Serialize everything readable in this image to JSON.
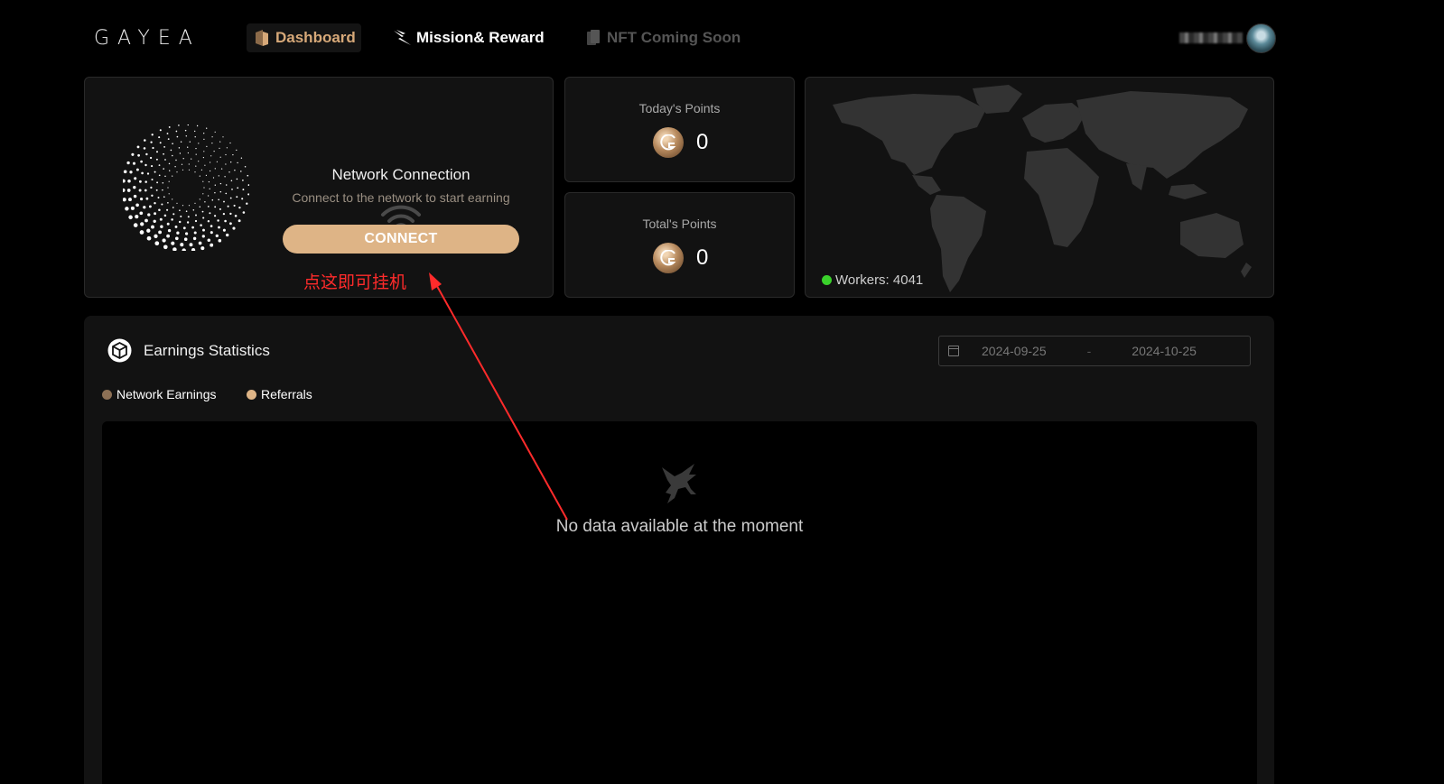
{
  "header": {
    "logo": "GAYEA",
    "nav": [
      {
        "label": "Dashboard",
        "icon": "dashboard-icon",
        "active": true
      },
      {
        "label": "Mission& Reward",
        "icon": "mission-icon",
        "active": false
      },
      {
        "label": "NFT Coming Soon",
        "icon": "nft-icon",
        "active": false
      }
    ]
  },
  "network": {
    "title": "Network Connection",
    "subtitle": "Connect to the network to start earning",
    "button": "CONNECT"
  },
  "today": {
    "label": "Today's Points",
    "value": "0"
  },
  "total": {
    "label": "Total's Points",
    "value": "0"
  },
  "map": {
    "workers_label": "Workers: 4041",
    "status_color": "#3ad12b"
  },
  "earnings": {
    "title": "Earnings Statistics",
    "date_start": "2024-09-25",
    "date_sep": "-",
    "date_end": "2024-10-25",
    "legend": [
      {
        "label": "Network Earnings",
        "color": "#8c7055"
      },
      {
        "label": "Referrals",
        "color": "#deb486"
      }
    ],
    "empty_text": "No data available at the moment"
  },
  "annotation": {
    "text": "点这即可挂机",
    "color": "#ff2b2b"
  },
  "colors": {
    "accent": "#deb486",
    "background": "#000000",
    "card": "#121212"
  }
}
